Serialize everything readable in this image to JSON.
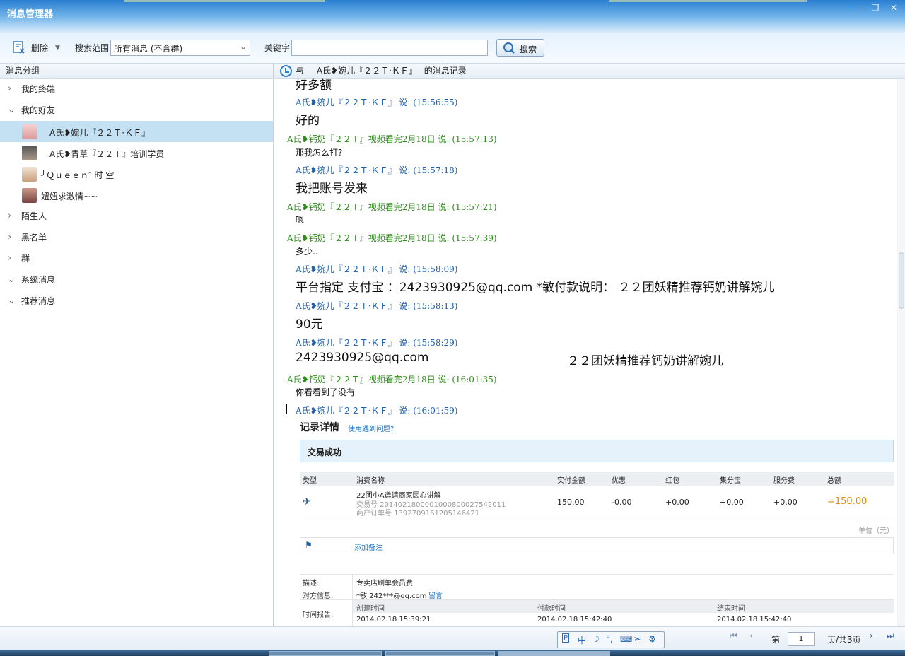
{
  "window": {
    "title": "消息管理器",
    "controls": [
      "minimize",
      "restore",
      "close"
    ]
  },
  "toolbar": {
    "delete_label": "删除",
    "scope_label": "搜索范围",
    "scope_value": "所有消息 (不含群)",
    "keyword_label": "关键字",
    "keyword_value": "",
    "search_label": "搜索"
  },
  "left_panel": {
    "header": "消息分组",
    "groups": [
      {
        "label": "我的终端",
        "expanded": false
      },
      {
        "label": "我的好友",
        "expanded": true
      },
      {
        "label": "陌生人",
        "expanded": false
      },
      {
        "label": "黑名单",
        "expanded": false
      },
      {
        "label": "群",
        "expanded": false
      },
      {
        "label": "系统消息",
        "expanded": true
      },
      {
        "label": "推荐消息",
        "expanded": true
      }
    ],
    "friends": [
      {
        "name": "A氏❥婉儿『２２Ｔ·ＫＦ』",
        "selected": true
      },
      {
        "name": "A氏❥青草『２２Ｔ』培训学员",
        "selected": false
      },
      {
        "name": "╯Ｑｕｅｅｎ″ 时 空",
        "selected": false
      },
      {
        "name": "妞妞求激情~~",
        "selected": false
      }
    ]
  },
  "chat": {
    "header_prefix": "与",
    "header_contact": "A氏❥婉儿『２２Ｔ·ＫＦ』",
    "header_suffix": "的消息记录",
    "partial_top": "好多额",
    "messages": [
      {
        "sender": "A氏❥婉儿『２２Ｔ·ＫＦ』 说:",
        "time": "(15:56:55)",
        "text": "好的",
        "side": "blue"
      },
      {
        "sender": "A氏❥钙奶『２２Ｔ』视频看完2月18日 说:",
        "time": "(15:57:13)",
        "text": "那我怎么打?",
        "side": "green"
      },
      {
        "sender": "A氏❥婉儿『２２Ｔ·ＫＦ』 说:",
        "time": "(15:57:18)",
        "text": "我把账号发来",
        "side": "blue"
      },
      {
        "sender": "A氏❥钙奶『２２Ｔ』视频看完2月18日 说:",
        "time": "(15:57:21)",
        "text": "嗯",
        "side": "green"
      },
      {
        "sender": "A氏❥钙奶『２２Ｔ』视频看完2月18日 说:",
        "time": "(15:57:39)",
        "text": "多少..",
        "side": "green"
      },
      {
        "sender": "A氏❥婉儿『２２Ｔ·ＫＦ』 说:",
        "time": "(15:58:09)",
        "text": "平台指定 支付宝 ：2423930925@qq.com *敏付款说明： ２２团妖精推荐钙奶讲解婉儿",
        "side": "blue"
      },
      {
        "sender": "A氏❥婉儿『２２Ｔ·ＫＦ』 说:",
        "time": "(15:58:13)",
        "text": "90元",
        "side": "blue"
      },
      {
        "sender": "A氏❥婉儿『２２Ｔ·ＫＦ』 说:",
        "time": "(15:58:29)",
        "text": "2423930925@qq.com",
        "text2": "２２团妖精推荐钙奶讲解婉儿",
        "side": "blue"
      },
      {
        "sender": "A氏❥钙奶『２２Ｔ』视频看完2月18日 说:",
        "time": "(16:01:35)",
        "text": "你看看到了没有",
        "side": "green"
      },
      {
        "sender": "A氏❥婉儿『２２Ｔ·ＫＦ』 说:",
        "time": "(16:01:59)",
        "text": "",
        "side": "blue"
      }
    ]
  },
  "receipt": {
    "title": "记录详情",
    "help_link": "使用遇到问题?",
    "status": "交易成功",
    "columns": [
      "类型",
      "消费名称",
      "实付金额",
      "优惠",
      "红包",
      "集分宝",
      "服务费",
      "总额"
    ],
    "item_name": "22团小A邀请商家因心讲解",
    "trade_no": "交易号 2014021800001000800027542011",
    "order_no": "商户订单号 1392709161205146421",
    "paid": "150.00",
    "discount": "-0.00",
    "red_packet": "+0.00",
    "points": "+0.00",
    "fee": "+0.00",
    "total": "=150.00",
    "unit": "单位（元）",
    "add_note": "添加备注",
    "desc_label": "描述:",
    "desc_value": "专卖店刷单会员费",
    "counterparty_label": "对方信息:",
    "counterparty_value": "*敏 242***@qq.com",
    "message_link": "留言",
    "time_label": "时间报告:",
    "created_label": "创建时间",
    "paid_label": "付款时间",
    "end_label": "结束时间",
    "created": "2014.02.18 15:39:21",
    "paid_time": "2014.02.18 15:42:40",
    "end_time": "2014.02.18 15:42:40"
  },
  "pager": {
    "page_label": "第",
    "page_value": "1",
    "total_label": "页/共3页"
  },
  "ime": {
    "items": [
      "中",
      "☽",
      "°,",
      "⌨",
      "✂",
      "🔧"
    ]
  }
}
